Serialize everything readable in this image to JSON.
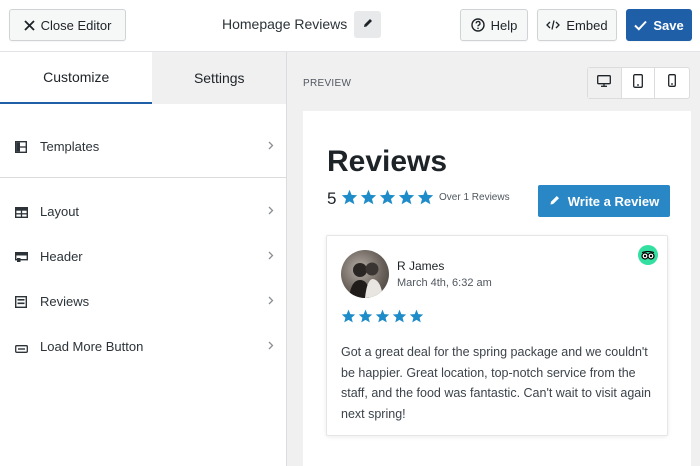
{
  "topbar": {
    "close_label": "Close Editor",
    "title": "Homepage Reviews",
    "help_label": "Help",
    "embed_label": "Embed",
    "save_label": "Save"
  },
  "sidebar": {
    "tabs": [
      {
        "label": "Customize",
        "active": true
      },
      {
        "label": "Settings",
        "active": false
      }
    ],
    "items": [
      {
        "label": "Templates",
        "icon": "templates-icon"
      },
      {
        "label": "Layout",
        "icon": "layout-icon"
      },
      {
        "label": "Header",
        "icon": "header-icon"
      },
      {
        "label": "Reviews",
        "icon": "reviews-icon"
      },
      {
        "label": "Load More Button",
        "icon": "load-more-icon"
      }
    ]
  },
  "preview": {
    "label": "PREVIEW",
    "devices": [
      "desktop-icon",
      "tablet-icon",
      "mobile-icon"
    ],
    "active_device": "desktop",
    "heading": "Reviews",
    "rating": "5",
    "stars": 5,
    "review_count": "Over 1 Reviews",
    "write_button": "Write a Review",
    "review": {
      "name": "R James",
      "date": "March 4th, 6:32 am",
      "stars": 5,
      "source_icon": "tripadvisor-icon",
      "text": "Got a great deal for the spring package and we couldn't be happier. Great location, top-notch service from the staff, and the food was fantastic. Can't wait to visit again next spring!"
    }
  },
  "colors": {
    "accent": "#1e5fa8",
    "star": "#1e8cc8",
    "write_button": "#2987c6",
    "tripadvisor": "#34e0a1"
  }
}
